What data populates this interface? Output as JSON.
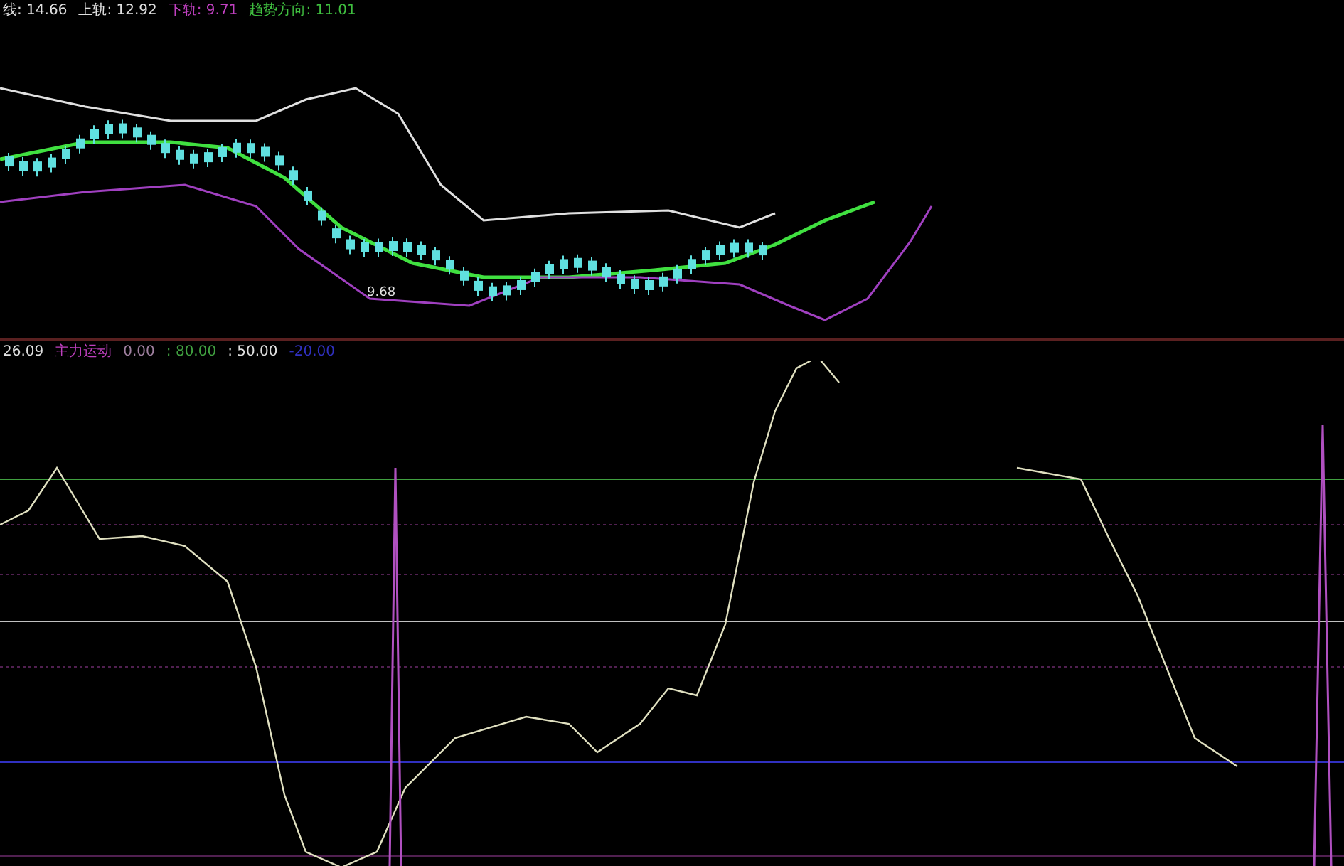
{
  "price_legend": [
    {
      "text": "线: 14.66",
      "color": "#e0e0e0"
    },
    {
      "text": "上轨: 12.92",
      "color": "#e0e0e0"
    },
    {
      "text": "下轨: 9.71",
      "color": "#c040c0"
    },
    {
      "text": "趋势方向: 11.01",
      "color": "#40c040"
    }
  ],
  "indicator_legend": {
    "value": "26.09",
    "items": [
      {
        "text": "主力运动",
        "color": "#c040c0"
      },
      {
        "text": "0.00",
        "color": "#a080a0"
      },
      {
        "text": ": 80.00",
        "color": "#40a040"
      },
      {
        "text": ": 50.00",
        "color": "#e0e0e0"
      },
      {
        "text": "-20.00",
        "color": "#3030c0"
      }
    ]
  },
  "low_label": "9.68"
}
